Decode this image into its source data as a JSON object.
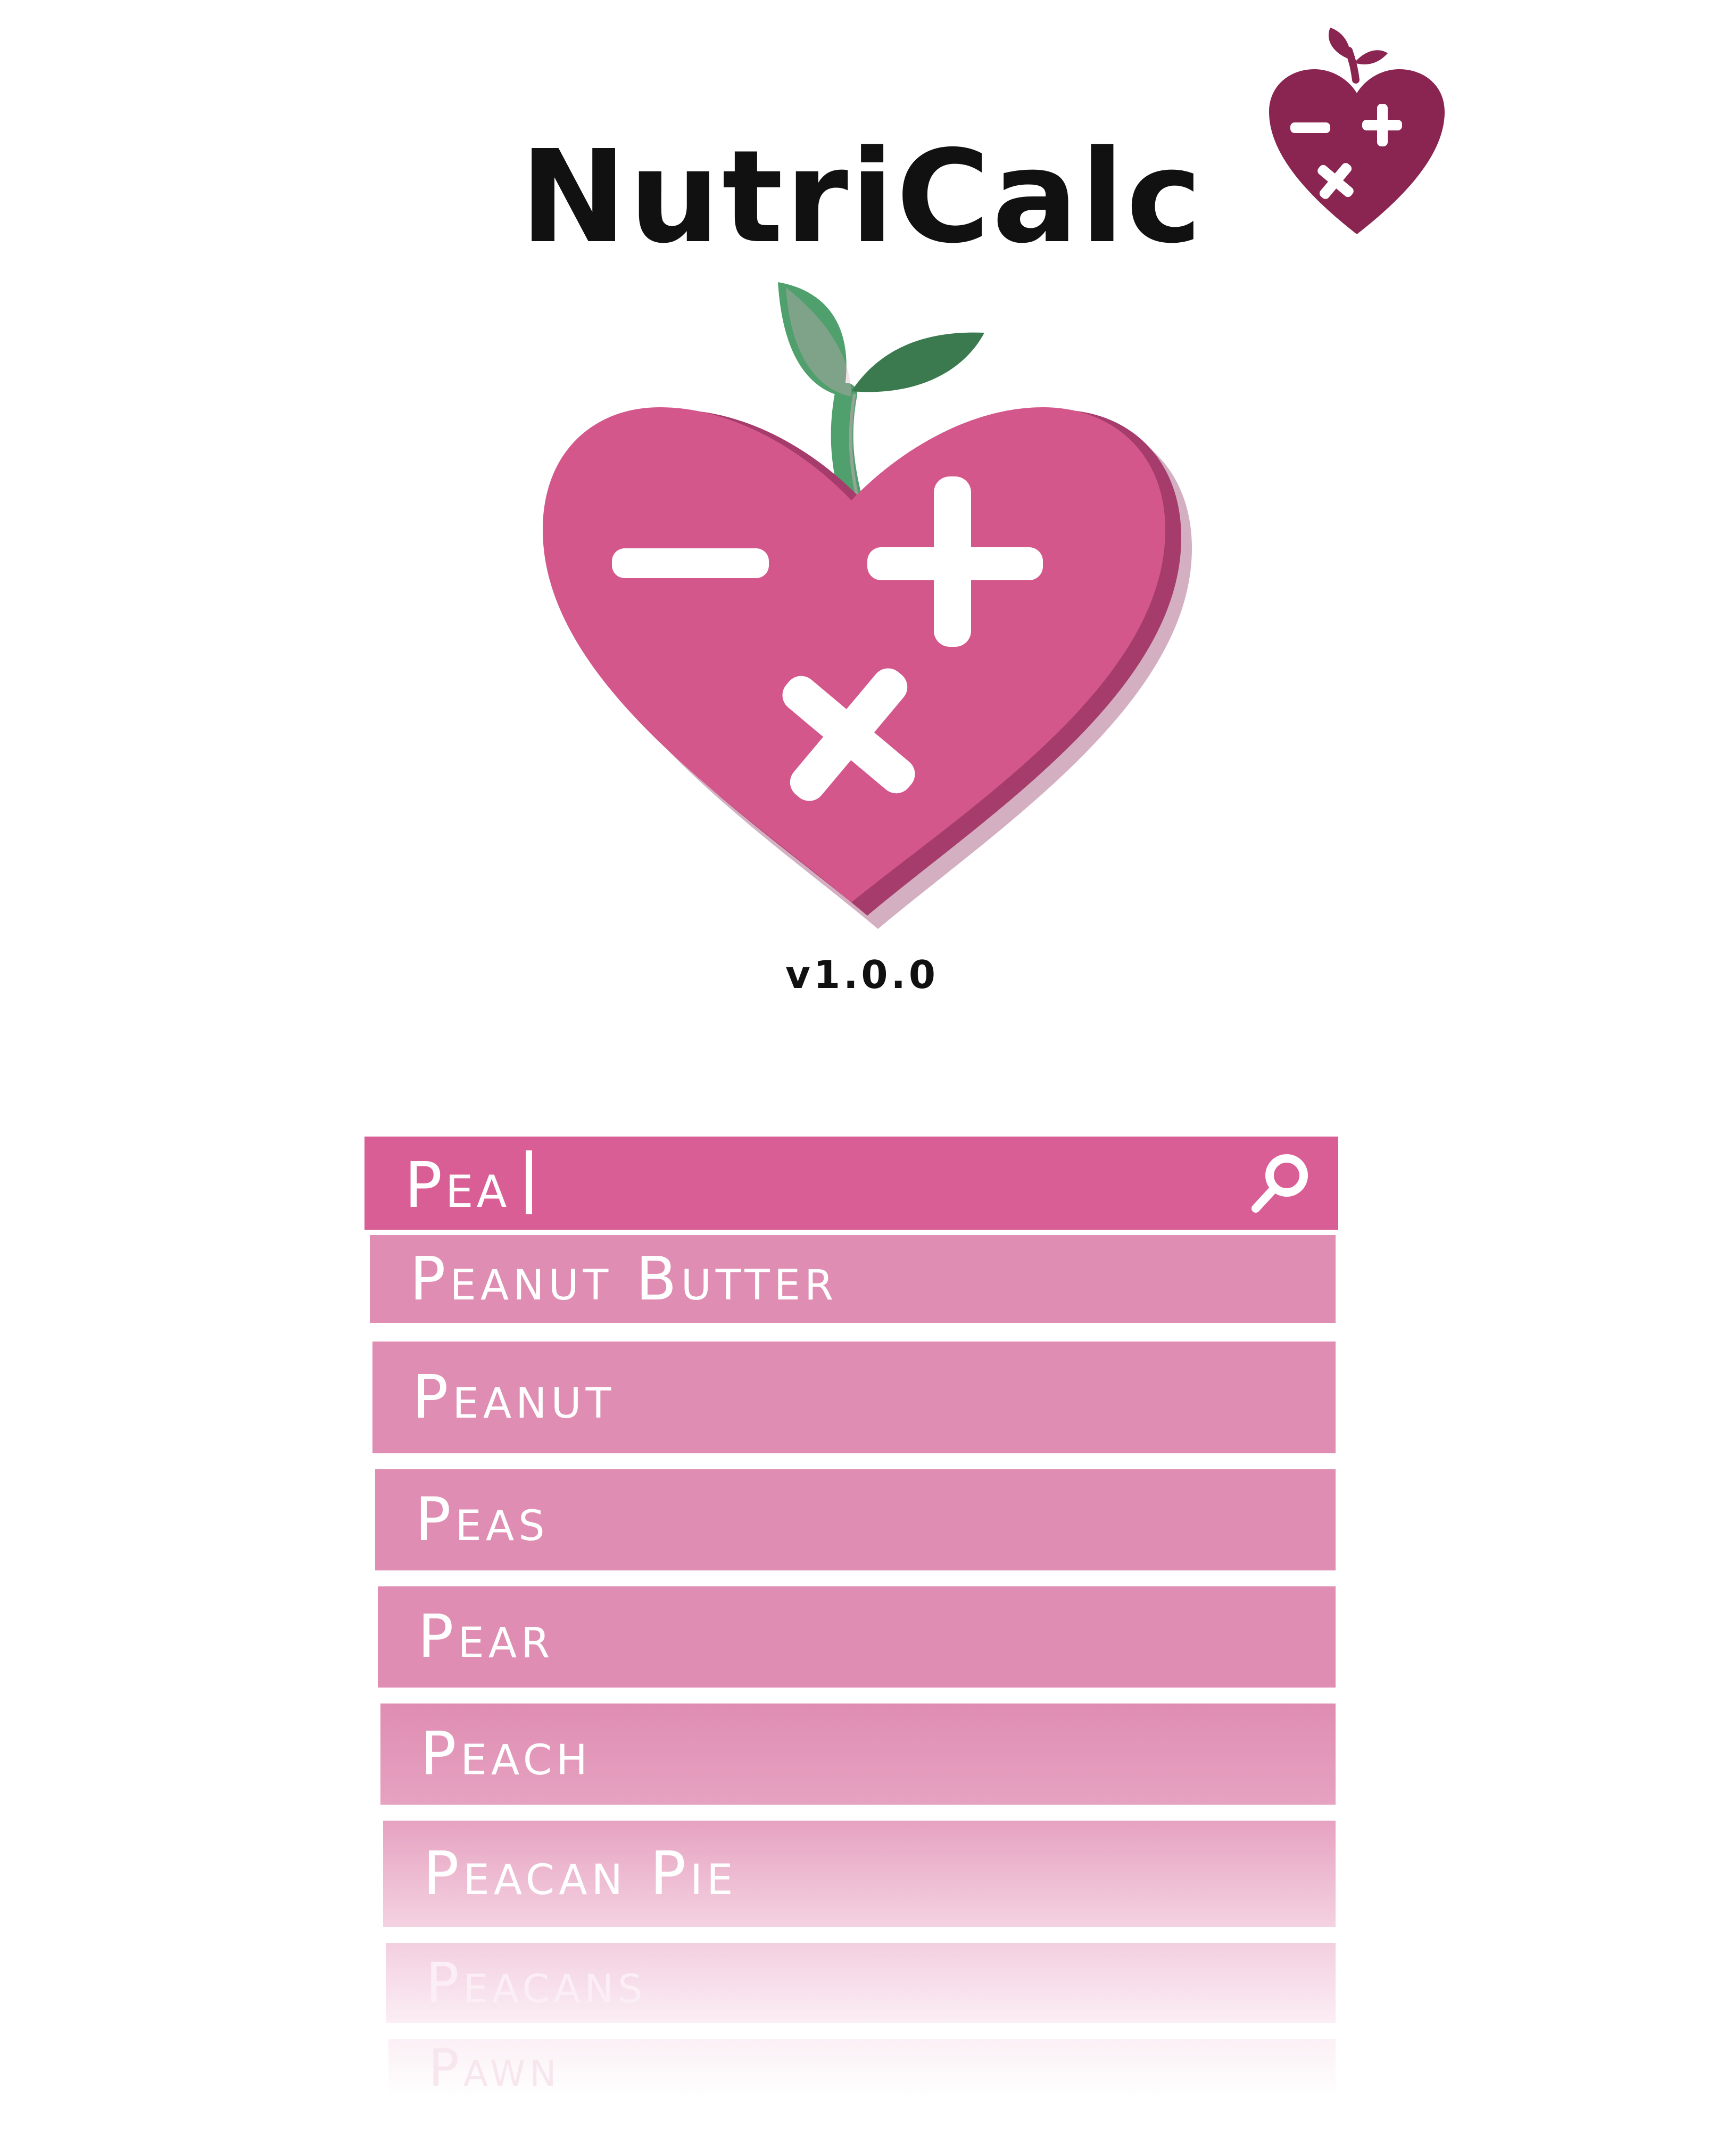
{
  "app": {
    "title": "NutriCalc",
    "version": "v1.0.0"
  },
  "search": {
    "value": "Pea",
    "icon": "magnifier-icon"
  },
  "suggestions": [
    {
      "label": "Peanut Butter"
    },
    {
      "label": "Peanut"
    },
    {
      "label": "Peas"
    },
    {
      "label": "Pear"
    },
    {
      "label": "Peach"
    },
    {
      "label": "Peacan Pie"
    },
    {
      "label": "Peacans"
    },
    {
      "label": "Pawn"
    }
  ],
  "colors": {
    "heart": "#d4578c",
    "heart_shadow": "#a63c6c",
    "leaf_light": "#4fa06c",
    "leaf_dark": "#3a7a4e",
    "corner_logo": "#8a2450",
    "search_bar": "#d95e96",
    "suggestion": "#df8db2"
  }
}
